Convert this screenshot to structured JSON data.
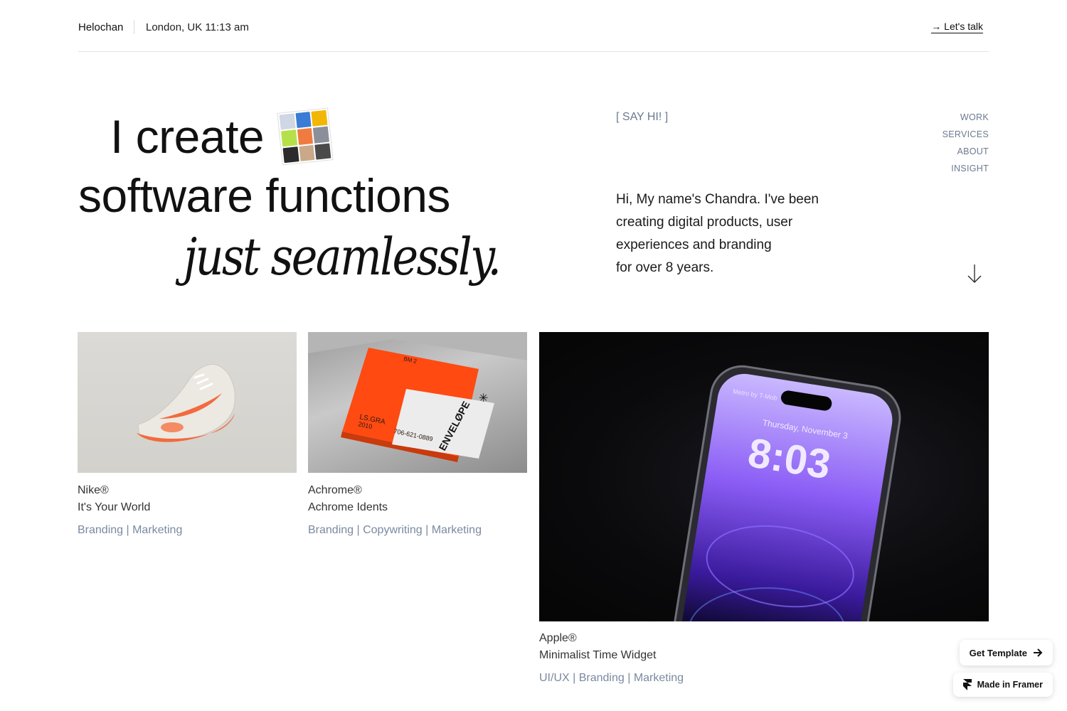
{
  "header": {
    "brand": "Helochan",
    "location_time": "London, UK 11:13 am",
    "cta": "→ Let's talk"
  },
  "hero": {
    "line1": "I create",
    "line2": "software functions",
    "line3": "just seamlessly."
  },
  "say_hi": "[ SAY HI! ]",
  "nav": {
    "items": [
      {
        "label": "WORK"
      },
      {
        "label": "SERVICES"
      },
      {
        "label": "ABOUT"
      },
      {
        "label": "INSIGHT"
      }
    ]
  },
  "intro": {
    "lines": [
      "Hi, My name's Chandra. I've been",
      "creating digital products, user",
      "experiences and branding",
      "for over 8 years."
    ]
  },
  "projects": [
    {
      "brand": "Nike®",
      "title": "It's Your World",
      "tags": "Branding | Marketing"
    },
    {
      "brand": "Achrome®",
      "title": "Achrome Idents",
      "tags": "Branding | Copywriting | Marketing"
    },
    {
      "brand": "Apple®",
      "title": "Minimalist Time Widget",
      "tags": "UI/UX | Branding | Marketing"
    }
  ],
  "media": {
    "envelope": {
      "line1": "ENVELØPE",
      "line2": "LS.GRA",
      "line3": "2010",
      "line4": "706-621-0889",
      "corner": "BM 2"
    },
    "phone": {
      "carrier": "Metro by T-Mob",
      "date": "Thursday, November 3",
      "time": "8:03"
    }
  },
  "badges": {
    "template": "Get Template",
    "framer": "Made in Framer"
  },
  "icons": {
    "down_arrow": "arrow-down-icon",
    "template_arrow": "arrow-right-icon",
    "framer_logo": "framer-logo-icon"
  },
  "colors": {
    "muted": "#6b7a90",
    "tags": "#7a8aa0",
    "nike_orange": "#f26a3d",
    "achrome_orange": "#ff4a12",
    "phone_purple": "#7b4cf0"
  }
}
